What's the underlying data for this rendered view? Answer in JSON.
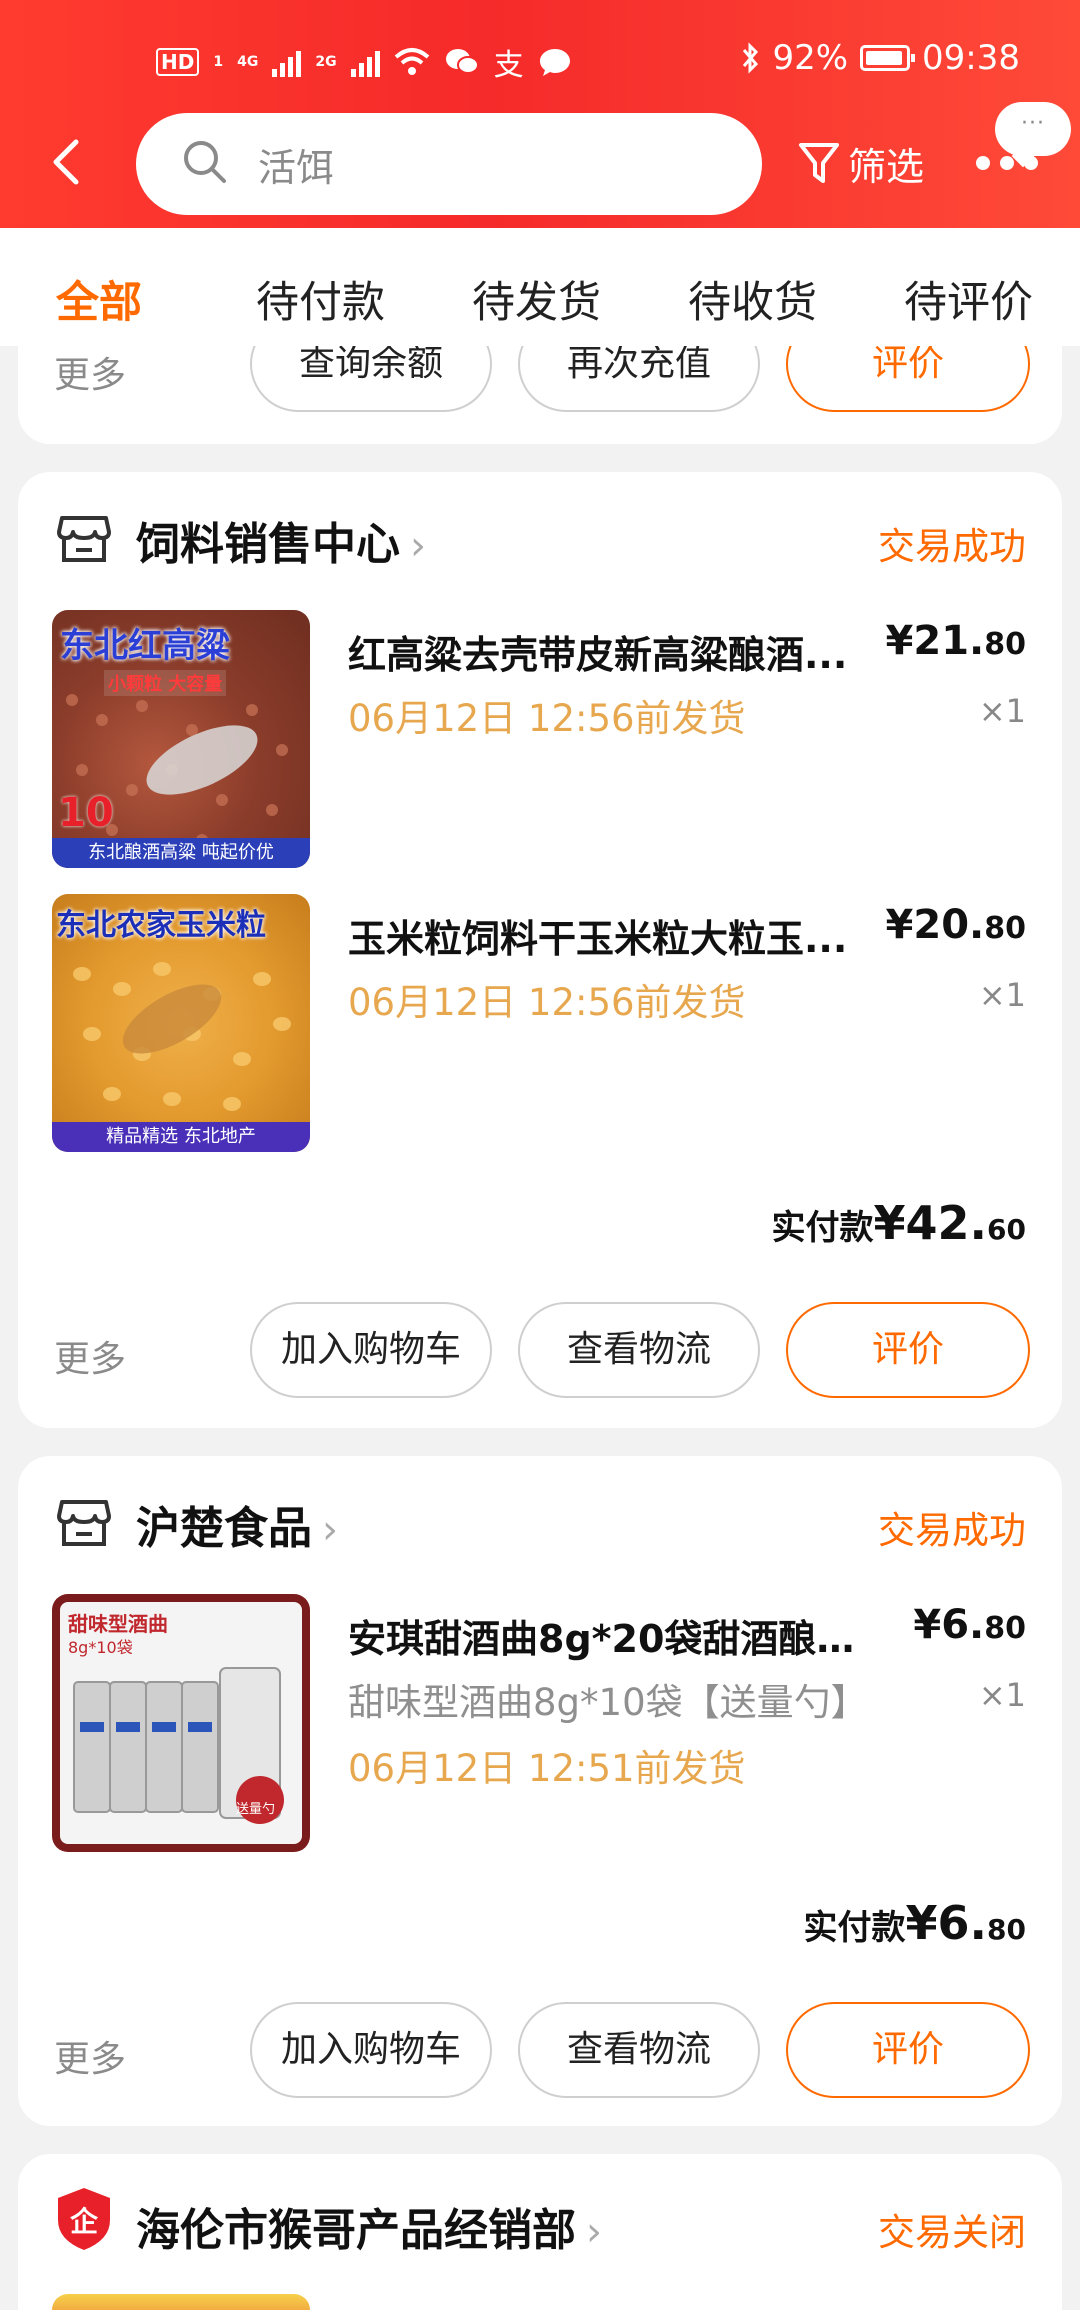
{
  "status_bar": {
    "hd": "HD",
    "sim": "1",
    "net1": "4G",
    "net2": "2G",
    "alipay_glyph": "支",
    "battery": "92%",
    "time": "09:38"
  },
  "header": {
    "search_text": "活饵",
    "filter_label": "筛选",
    "bubble_text": "···",
    "accent_color": "#f52a2a"
  },
  "tabs": [
    "全部",
    "待付款",
    "待发货",
    "待收货",
    "待评价"
  ],
  "top_card": {
    "more": "更多",
    "buttons": [
      "查询余额",
      "再次充值",
      "评价"
    ]
  },
  "orders": [
    {
      "shop": "饲料销售中心",
      "status": "交易成功",
      "items": [
        {
          "title": "红高粱去壳带皮新高粱酿酒...",
          "price_yuan": "¥21.",
          "price_cents": "80",
          "qty": "×1",
          "ship": "06月12日 12:56前发货",
          "img_text": "东北红高粱",
          "img_sub": "小颗粒 大容量",
          "img_badge": "10",
          "img_foot": "东北酿酒高粱 吨起价优"
        },
        {
          "title": "玉米粒饲料干玉米粒大粒玉...",
          "price_yuan": "¥20.",
          "price_cents": "80",
          "qty": "×1",
          "ship": "06月12日 12:56前发货",
          "img_text": "东北农家玉米粒",
          "img_foot": "精品精选 东北地产"
        }
      ],
      "total_label": "实付款",
      "total_yuan": "¥42.",
      "total_cents": "60",
      "more": "更多",
      "buttons": [
        "加入购物车",
        "查看物流",
        "评价"
      ]
    },
    {
      "shop": "沪楚食品",
      "status": "交易成功",
      "items": [
        {
          "title": "安琪甜酒曲8g*20袋甜酒酿家...",
          "price_yuan": "¥6.",
          "price_cents": "80",
          "qty": "×1",
          "sku": "甜味型酒曲8g*10袋【送量勺】",
          "ship": "06月12日 12:51前发货",
          "img_text": "甜味型酒曲",
          "img_sub": "8g*10袋",
          "img_badge": "送量勺"
        }
      ],
      "total_label": "实付款",
      "total_yuan": "¥6.",
      "total_cents": "80",
      "more": "更多",
      "buttons": [
        "加入购物车",
        "查看物流",
        "评价"
      ]
    },
    {
      "shop": "海伦市猴哥产品经销部",
      "status": "交易关闭",
      "shop_badge": "企"
    }
  ]
}
